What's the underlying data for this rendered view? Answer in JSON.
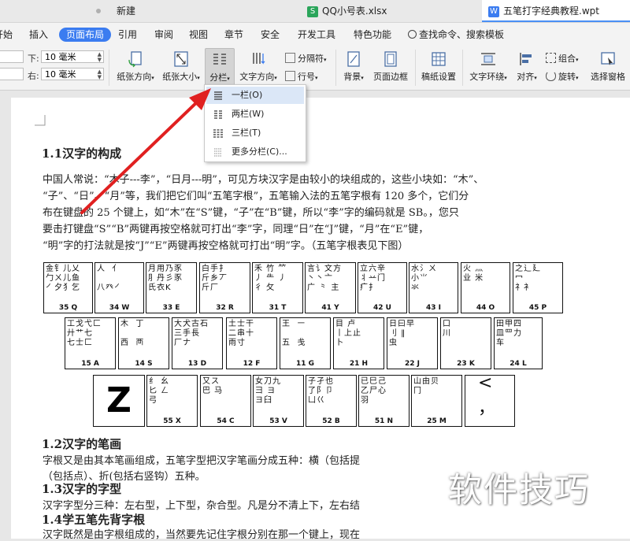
{
  "tabs": [
    {
      "label": "新建",
      "icon": "dot-icon"
    },
    {
      "label": "QQ小号表.xlsx",
      "icon": "sheet-icon"
    },
    {
      "label": "五笔打字经典教程.wpt",
      "icon": "doc-icon"
    }
  ],
  "menu": [
    {
      "label": "开始"
    },
    {
      "label": "插入"
    },
    {
      "label": "页面布局",
      "active": true
    },
    {
      "label": "引用"
    },
    {
      "label": "审阅"
    },
    {
      "label": "视图"
    },
    {
      "label": "章节"
    },
    {
      "label": "安全"
    },
    {
      "label": "开发工具"
    },
    {
      "label": "特色功能"
    }
  ],
  "search": {
    "label": "查找命令、搜索模板"
  },
  "margins": {
    "top_value": "",
    "bottom_value": "",
    "down_label": "下:",
    "down_value": "10 毫米",
    "right_label": "右:",
    "right_value": "10 毫米"
  },
  "ribbon": {
    "orientation": "纸张方向",
    "size": "纸张大小",
    "columns": "分栏",
    "text_direction": "文字方向",
    "breaks": "分隔符",
    "line_numbers": "行号",
    "background": "背景",
    "page_border": "页面边框",
    "grid_setup": "稿纸设置",
    "text_wrap": "文字环绕",
    "align": "对齐",
    "group": "组合",
    "rotate": "旋转",
    "selection_pane": "选择窗格"
  },
  "columns_menu": [
    {
      "label": "一栏(O)",
      "hover": true
    },
    {
      "label": "两栏(W)"
    },
    {
      "label": "三栏(T)"
    },
    {
      "label": "更多分栏(C)..."
    }
  ],
  "doc": {
    "h1": "1.1汉字的构成",
    "p1": [
      "中国人常说：“木子---李”，“日月---明”，可见方块汉字是由较小的块组成的，这些小块如：“木”、",
      "“子”、“日”、“月”等，我们把它们叫“五笔字根”，五笔输入法的五笔字根有 120 多个，它们分",
      "布在键盘的 25 个键上，如“木”在“S”键，“子”在“B”键，所以“李”字的编码就是 SB。，您只",
      "要击打键盘“S”“B”两键再按空格就可打出“李”字，同理“日”在“J”键，“月”在“E”键，",
      "“明”字的打法就是按“J”“E”两键再按空格就可打出“明”字。（五笔字根表见下图）"
    ],
    "h2": "1.2汉字的笔画",
    "p2": [
      "字根又是由其本笔画组成，五笔字型把汉字笔画分成五种：横（包括提",
      "（包括点）、折(包括右竖钩）五种。"
    ],
    "h3": "1.3汉字的字型",
    "p3": "汉字字型分三种：左右型，上下型，杂合型。凡是分不清上下，左右结",
    "h4": "1.4学五笔先背字根",
    "p4": "汉字既然是由字根组成的，当然要先记住字根分别在那一个键上，现在"
  },
  "keys_row1": [
    {
      "rad": "金钅儿乂\n勹ㄨ儿鱼\n㇒夕犭乞",
      "cap": "35 Q"
    },
    {
      "rad": "人  亻\n\n八癶㇒",
      "cap": "34 W"
    },
    {
      "rad": "月用乃豕\n⺼丹彡豕\n氏衣K",
      "cap": "33 E"
    },
    {
      "rad": "白手扌\n斤乡丆\n斤厂",
      "cap": "32 R"
    },
    {
      "rad": "禾 竹 ⺮\n丿 ⺧ 丿\n彳 攵",
      "cap": "31 T"
    },
    {
      "rad": "言讠文方\n丶丶亠\n广 ⺀ 主",
      "cap": "41 Y"
    },
    {
      "rad": "立六辛\n丬䒑门\n疒扌",
      "cap": "42 U"
    },
    {
      "rad": "水氵ㄨ\n小⺌\n氺",
      "cap": "43 I"
    },
    {
      "rad": "火 灬\n业 米\n",
      "cap": "44 O"
    },
    {
      "rad": "之辶廴\n冖\n礻衤",
      "cap": "45 P"
    }
  ],
  "keys_row2": [
    {
      "rad": "工戈弋匚\n廾艹七\n七士匚",
      "cap": "15 A"
    },
    {
      "rad": "木  丁\n\n西  襾",
      "cap": "14 S"
    },
    {
      "rad": "大犬古石\n三手長\n厂ナ",
      "cap": "13 D"
    },
    {
      "rad": "土士干\n二串十\n雨寸",
      "cap": "12 F"
    },
    {
      "rad": "王  ㇐\n\n五  戋",
      "cap": "11 G"
    },
    {
      "rad": "目 卢\n丨上止\n卜",
      "cap": "21 H"
    },
    {
      "rad": "日曰早\n刂 ‖\n虫",
      "cap": "22 J"
    },
    {
      "rad": "口\n川\n",
      "cap": "23 K"
    },
    {
      "rad": "田甲四\n皿罒力\n车",
      "cap": "24 L"
    }
  ],
  "keys_row3": [
    {
      "rad": "",
      "cap": "Z",
      "big": true
    },
    {
      "rad": "纟 幺\n匕 ㄥ\n弓",
      "cap": "55 X"
    },
    {
      "rad": "又ス\n巴 马\n",
      "cap": "54 C"
    },
    {
      "rad": "女刀九\n彐 ヨ\nヨ臼",
      "cap": "53 V"
    },
    {
      "rad": "子孑也\n了阝卩\n凵巜",
      "cap": "52 B"
    },
    {
      "rad": "已巳己\n乙尸心\n羽",
      "cap": "51 N"
    },
    {
      "rad": "山由贝\n冂\n",
      "cap": "25 M"
    },
    {
      "rad": "<\n\n，",
      "cap": ""
    }
  ],
  "watermark": "软件技巧",
  "colors": {
    "accent": "#3b7cf0",
    "arrow": "#e02020"
  }
}
